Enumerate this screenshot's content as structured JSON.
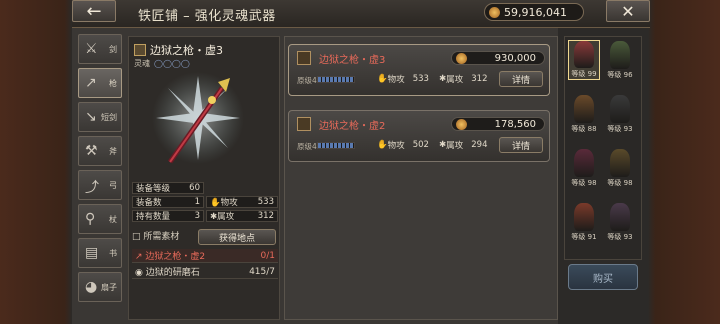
{
  "header": {
    "title": "铁匠铺 – 强化灵魂武器",
    "money": "59,916,041"
  },
  "tabs": [
    {
      "label": "剑",
      "icon": "sword-icon"
    },
    {
      "label": "枪",
      "icon": "spear-icon"
    },
    {
      "label": "短剑",
      "icon": "dagger-icon"
    },
    {
      "label": "斧",
      "icon": "axe-icon"
    },
    {
      "label": "弓",
      "icon": "bow-icon"
    },
    {
      "label": "杖",
      "icon": "staff-icon"
    },
    {
      "label": "书",
      "icon": "book-icon"
    },
    {
      "label": "扇子",
      "icon": "fan-icon"
    }
  ],
  "weapon": {
    "name": "边狱之枪・虚3",
    "soul_label": "灵魂"
  },
  "stats": {
    "equip_level_label": "装备等级",
    "equip_level": "60",
    "equipped_label": "装备数",
    "equipped": "1",
    "patk_label": "物攻",
    "patk": "533",
    "owned_label": "持有数量",
    "owned": "3",
    "eatk_label": "属攻",
    "eatk": "312"
  },
  "materials": {
    "header": "所需素材",
    "get_button": "获得地点",
    "items": [
      {
        "name": "边狱之枪・虚2",
        "count": "0/1"
      },
      {
        "name": "边狱的研磨石",
        "count": "415/7"
      }
    ]
  },
  "cards": [
    {
      "name": "边狱之枪・虚3",
      "price": "930,000",
      "level": "原级4",
      "patk_label": "物攻",
      "patk": "533",
      "eatk_label": "属攻",
      "eatk": "312",
      "detail": "详情"
    },
    {
      "name": "边狱之枪・虚2",
      "price": "178,560",
      "level": "原级4",
      "patk_label": "物攻",
      "patk": "502",
      "eatk_label": "属攻",
      "eatk": "294",
      "detail": "详情"
    }
  ],
  "party": [
    {
      "label": "等级 99",
      "color": "#8a3a3a"
    },
    {
      "label": "等级 96",
      "color": "#4a5a3a"
    },
    {
      "label": "等级 88",
      "color": "#6a4a2a"
    },
    {
      "label": "等级 93",
      "color": "#3a3a3a"
    },
    {
      "label": "等级 98",
      "color": "#5a2a3a"
    },
    {
      "label": "等级 98",
      "color": "#5a4a2a"
    },
    {
      "label": "等级 91",
      "color": "#7a3a2a"
    },
    {
      "label": "等级 93",
      "color": "#4a3a4a"
    }
  ],
  "buy_button": "购买"
}
